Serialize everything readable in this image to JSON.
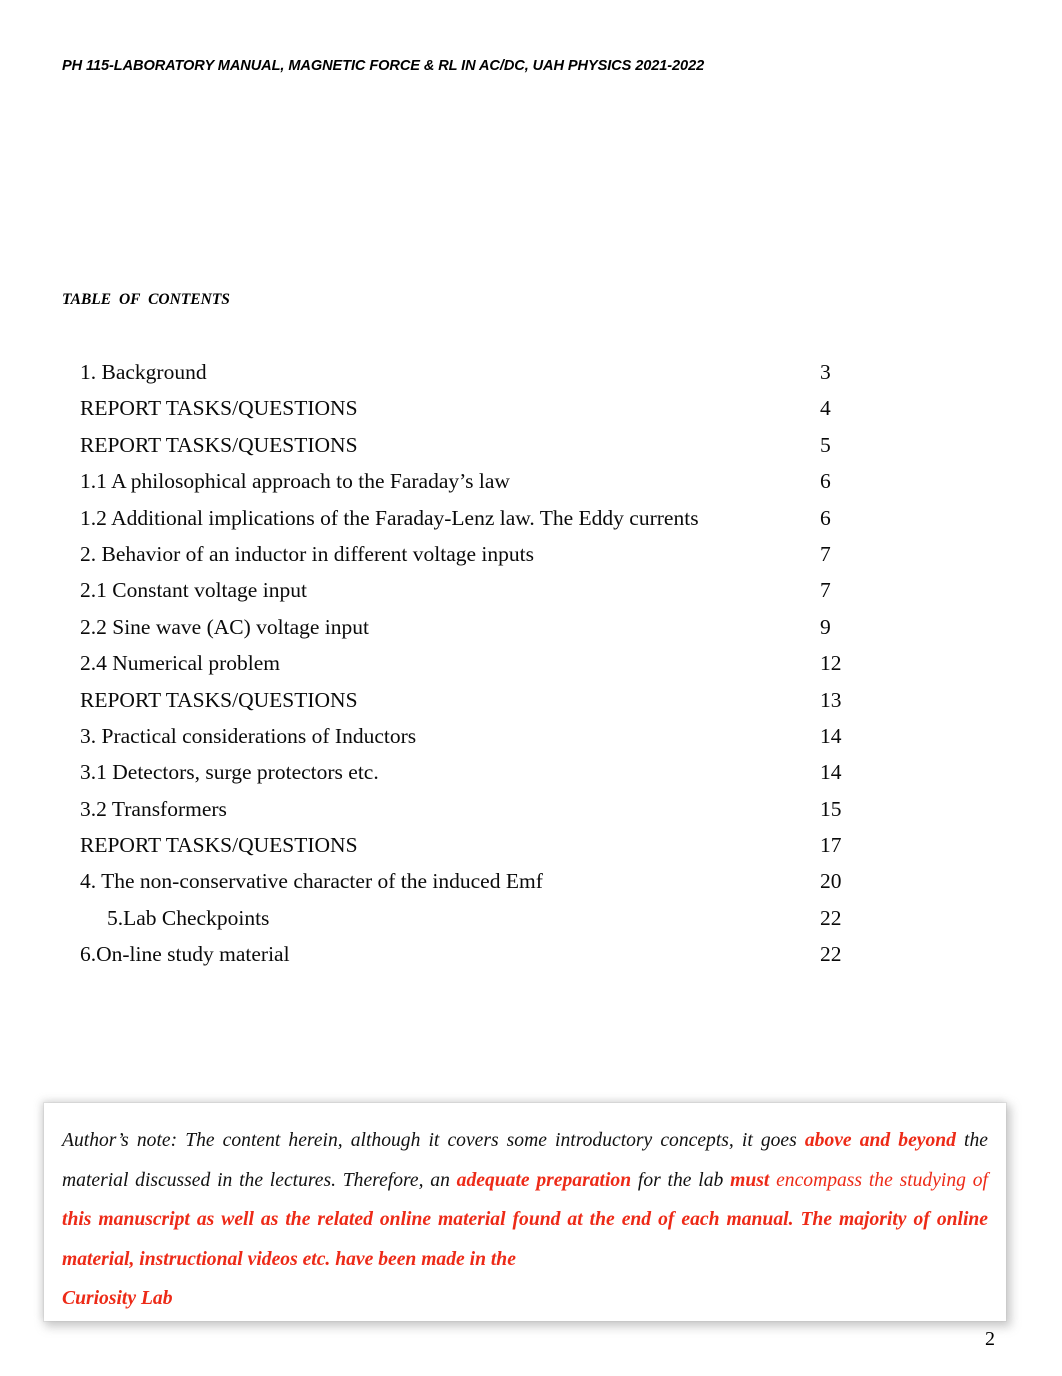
{
  "document": {
    "running_header": "PH 115-LABORATORY MANUAL, MAGNETIC FORCE & RL IN AC/DC, UAH PHYSICS 2021-2022",
    "page_number": "2",
    "accent_color": "#ED2A17"
  },
  "toc": {
    "caption": "TABLE OF CONTENTS",
    "entries": [
      {
        "title": "1. Background",
        "page": "3",
        "indent": false
      },
      {
        "title": "REPORT TASKS/QUESTIONS",
        "page": "4",
        "indent": false
      },
      {
        "title": "REPORT TASKS/QUESTIONS",
        "page": "5",
        "indent": false
      },
      {
        "title": "1.1 A philosophical approach to the Faraday’s law",
        "page": "6",
        "indent": false
      },
      {
        "title": "1.2 Additional implications of the Faraday-Lenz law. The Eddy currents",
        "page": "6",
        "indent": false
      },
      {
        "title": "2. Behavior of an inductor in different voltage inputs",
        "page": "7",
        "indent": false
      },
      {
        "title": "2.1 Constant voltage input",
        "page": "7",
        "indent": false
      },
      {
        "title": "2.2 Sine wave (AC) voltage input",
        "page": "9",
        "indent": false
      },
      {
        "title": "2.4 Numerical problem",
        "page": "12",
        "indent": false
      },
      {
        "title": "REPORT TASKS/QUESTIONS",
        "page": "13",
        "indent": false
      },
      {
        "title": "3. Practical considerations of Inductors",
        "page": "14",
        "indent": false
      },
      {
        "title": "3.1 Detectors, surge protectors etc.",
        "page": "14",
        "indent": false
      },
      {
        "title": "3.2 Transformers",
        "page": "15",
        "indent": false
      },
      {
        "title": "REPORT TASKS/QUESTIONS",
        "page": "17",
        "indent": false
      },
      {
        "title": "4. The non-conservative character of the induced Emf",
        "page": "20",
        "indent": false
      },
      {
        "title": "5.Lab Checkpoints",
        "page": "22",
        "indent": true
      },
      {
        "title": "6.On-line study material",
        "page": "22",
        "indent": false
      }
    ]
  },
  "author_note": {
    "segments": [
      {
        "text": "Author’s note: The content herein, although it covers some introductory concepts, it  goes ",
        "style": "plain"
      },
      {
        "text": "above and beyond",
        "style": "highlight"
      },
      {
        "text": " the material discussed in the lectures. Therefore, an ",
        "style": "plain"
      },
      {
        "text": "adequate preparation",
        "style": "highlight"
      },
      {
        "text": " for the lab ",
        "style": "plain"
      },
      {
        "text": "must ",
        "style": "highlight"
      },
      {
        "text": "encompass the studying of ",
        "style": "red"
      },
      {
        "text": "this manuscript as well as the related online material found at the end of each manual. The majority of online material, instructional videos etc. have been made in the ",
        "style": "highlight"
      },
      {
        "text": "Curiosity Lab",
        "style": "highlight-last"
      }
    ]
  }
}
